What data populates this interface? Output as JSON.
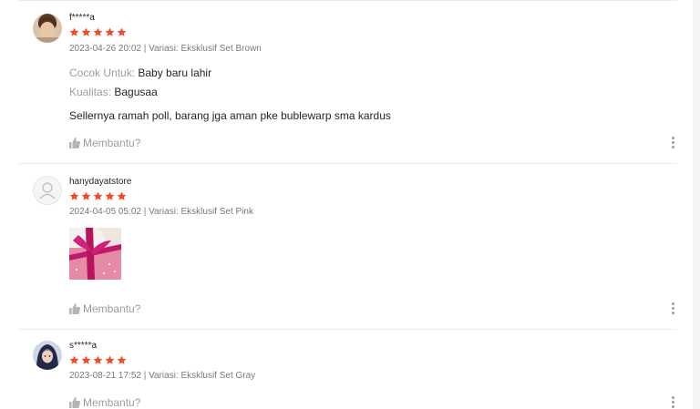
{
  "colors": {
    "star": "#ee4d2d",
    "muted": "#8a8a8a",
    "divider": "#ececec"
  },
  "icons": {
    "star": "star-icon",
    "helpful": "thumbs-up-icon",
    "more": "more-vertical-icon",
    "default_avatar": "user-icon"
  },
  "reviews": [
    {
      "username": "f*****a",
      "rating": 5,
      "meta": "2023-04-26 20:02 | Variasi: Eksklusif Set Brown",
      "attributes": [
        {
          "label": "Cocok Untuk:",
          "value": "Baby baru lahir"
        },
        {
          "label": "Kualitas:",
          "value": "Bagusaa"
        }
      ],
      "comment": "Sellernya ramah poll, barang jga aman pke bublewarp sma kardus",
      "helpful_label": "Membantu?"
    },
    {
      "username": "hanydayatstore",
      "rating": 5,
      "meta": "2024-04-05 05:02 | Variasi: Eksklusif Set Pink",
      "helpful_label": "Membantu?"
    },
    {
      "username": "s*****a",
      "rating": 5,
      "meta": "2023-08-21 17:52 | Variasi: Eksklusif Set Gray",
      "helpful_label": "Membantu?"
    }
  ]
}
